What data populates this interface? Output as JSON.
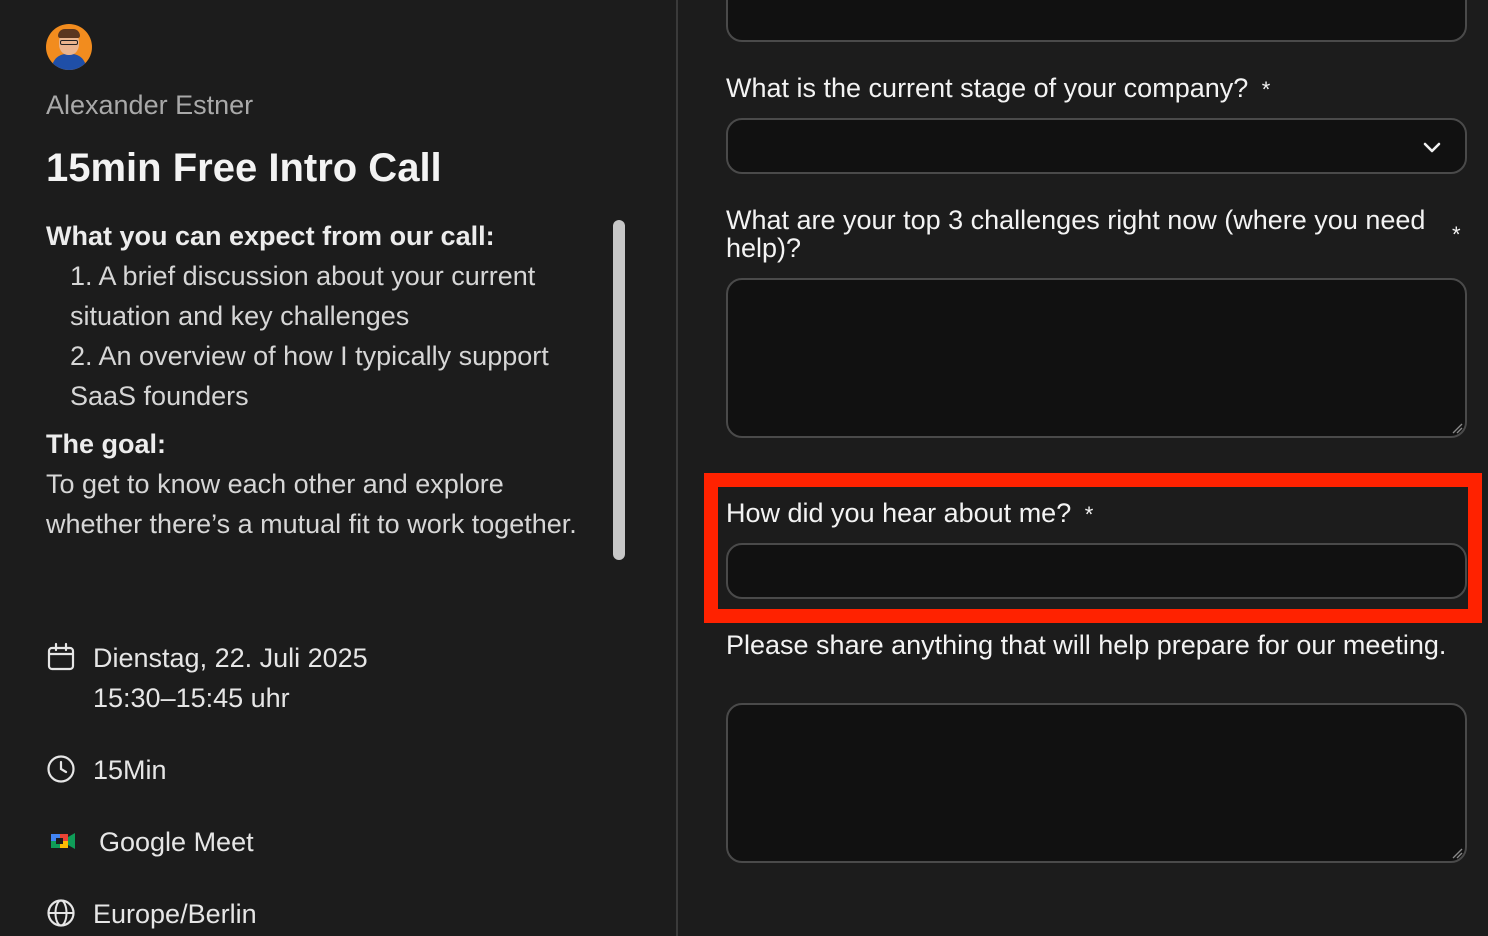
{
  "host": {
    "name": "Alexander Estner"
  },
  "event": {
    "title": "15min Free Intro Call",
    "expect_heading": "What you can expect from our call:",
    "expect_items": [
      "1. A brief discussion about your current situation and key challenges",
      "2. An overview of how I typically support SaaS founders"
    ],
    "goal_heading": "The goal:",
    "goal_text": "To get to know each other and explore whether there’s a mutual fit to work together."
  },
  "meta": {
    "date": "Dienstag, 22. Juli 2025",
    "time": "15:30–15:45 uhr",
    "duration": "15Min",
    "location": "Google Meet",
    "timezone": "Europe/Berlin",
    "icons": [
      "calendar-icon",
      "clock-icon",
      "google-meet-icon",
      "globe-icon"
    ]
  },
  "form": {
    "stage_label": "What is the current stage of your company?",
    "stage_value": "",
    "challenges_label": "What are your top 3 challenges right now (where you need help)?",
    "challenges_value": "",
    "hear_label": "How did you hear about me?",
    "hear_value": "",
    "share_label": "Please share anything that will help prepare for our meeting.",
    "share_value": "",
    "required_mark": "*"
  },
  "colors": {
    "background": "#1c1c1c",
    "field_bg": "#111111",
    "field_border": "#4a4a4a",
    "highlight": "#ff2200",
    "avatar_bg": "#f28c1e"
  }
}
